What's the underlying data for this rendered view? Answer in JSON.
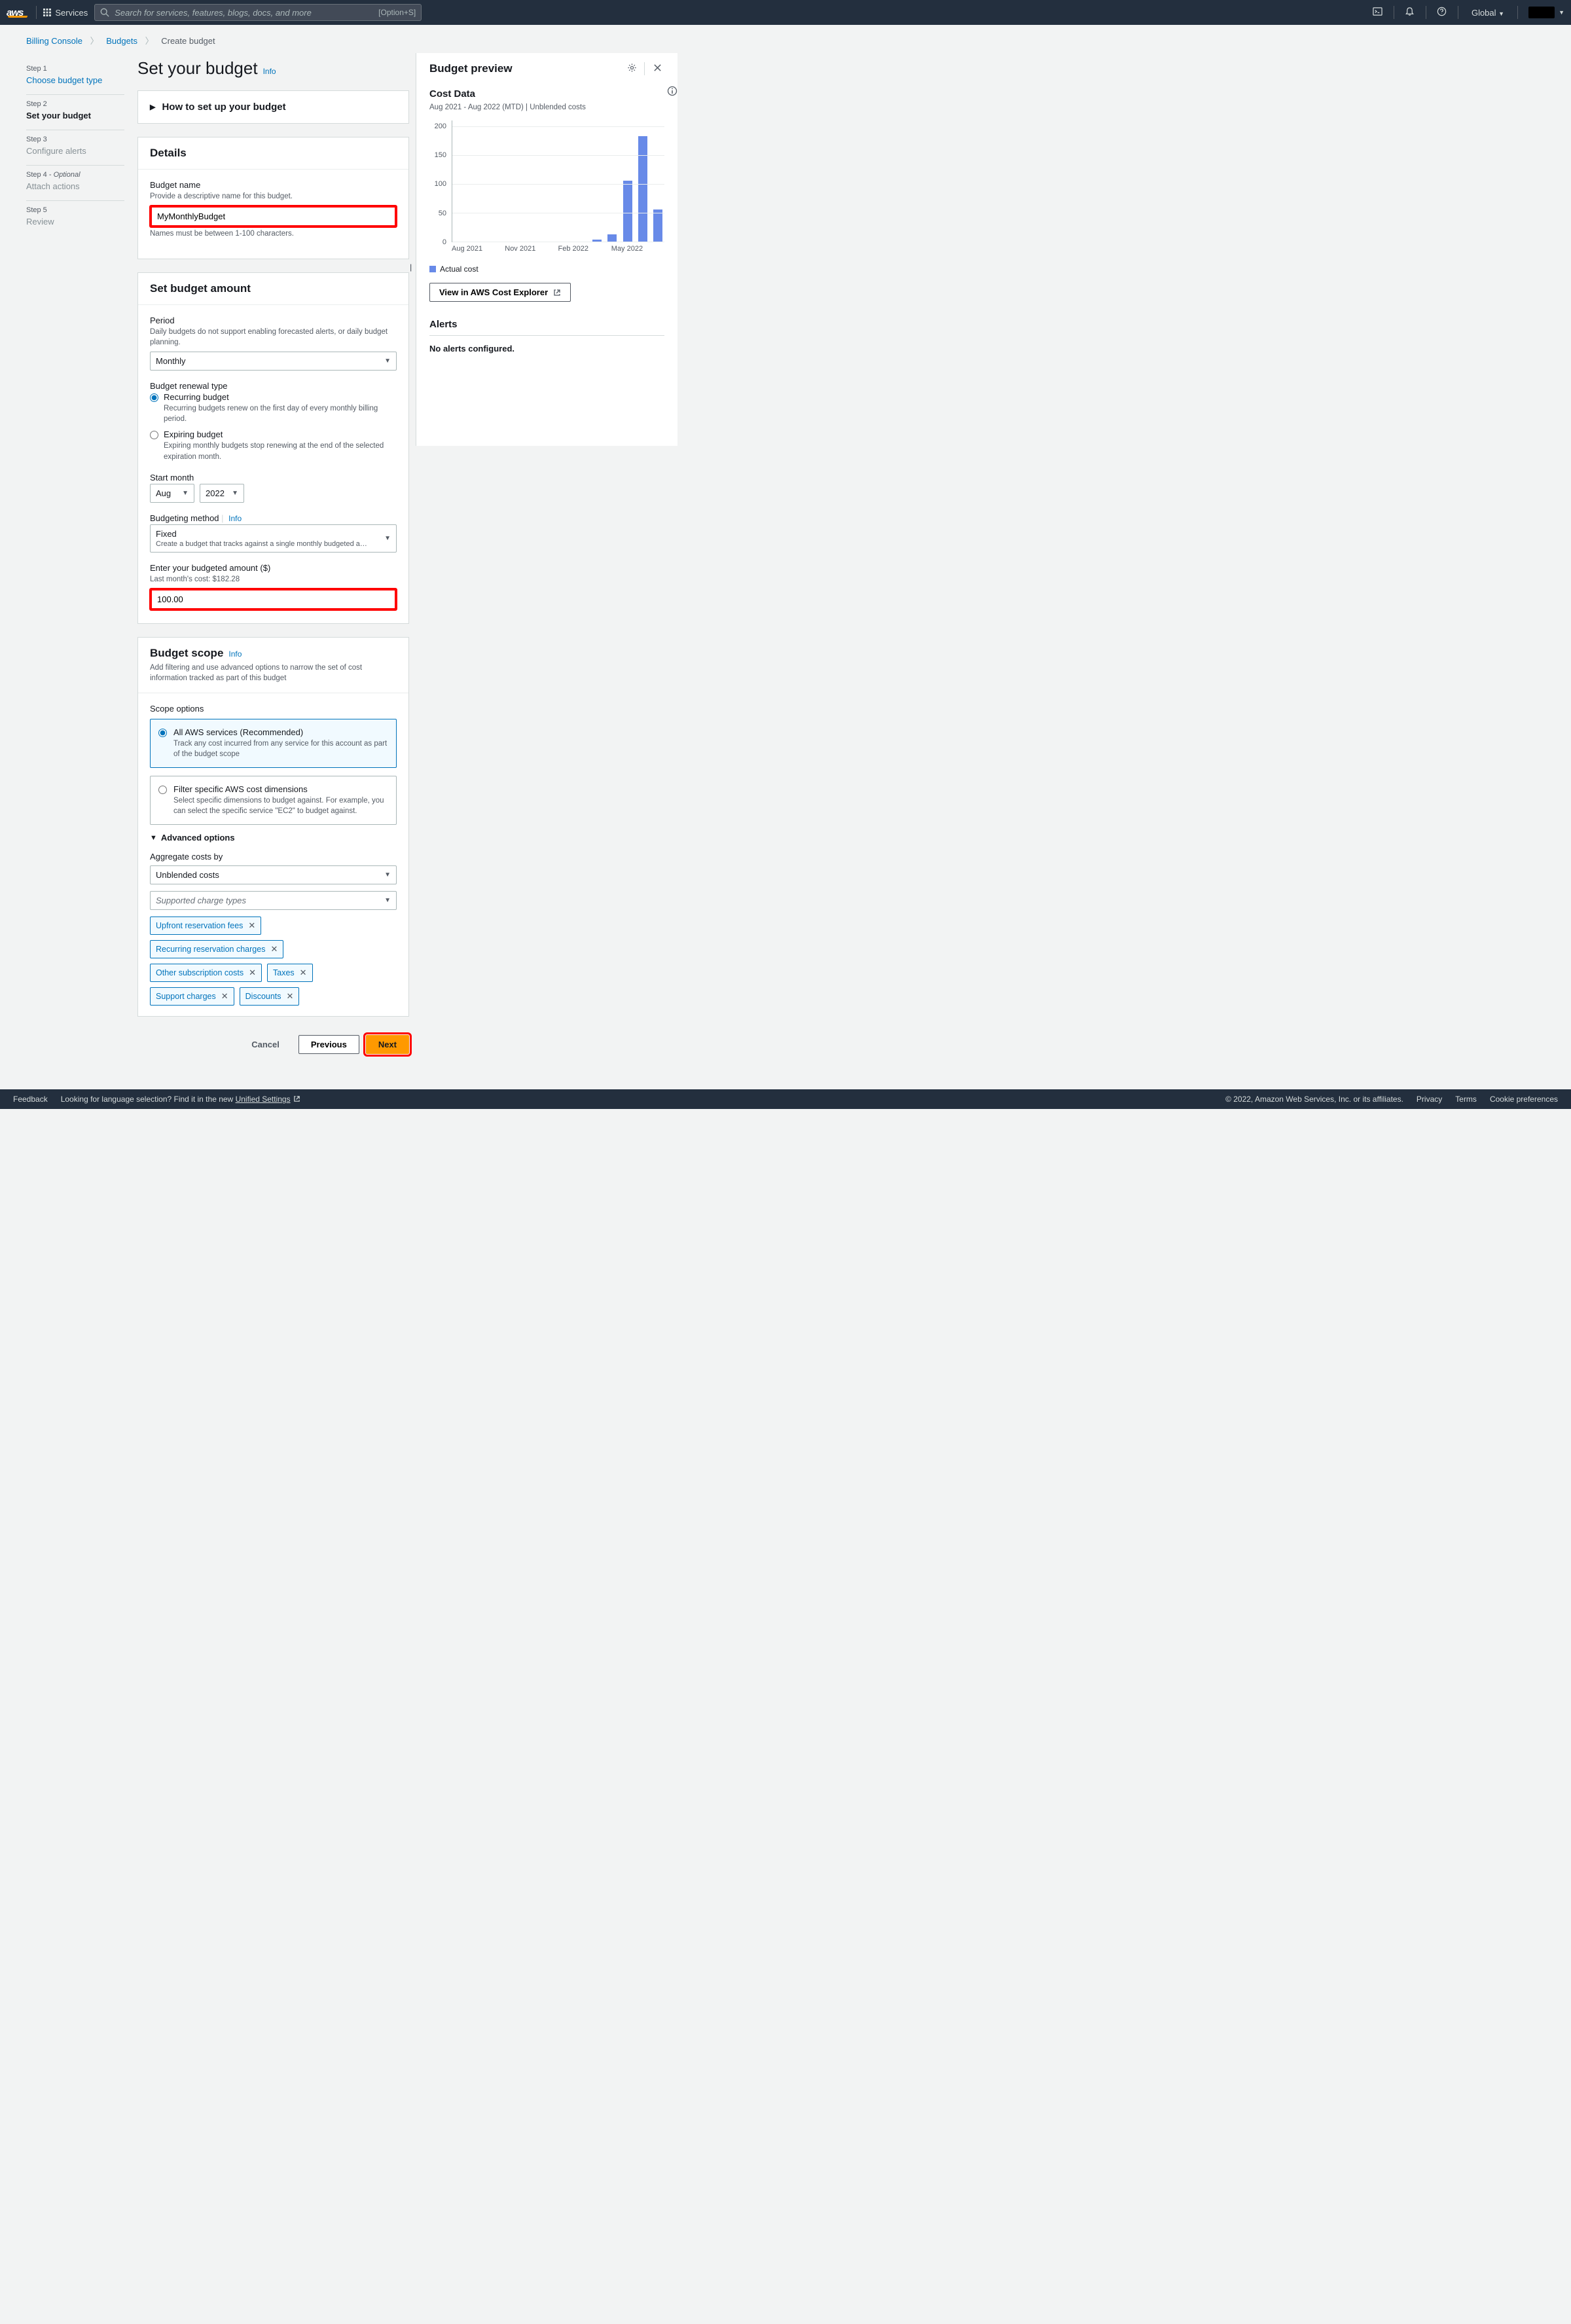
{
  "topnav": {
    "services": "Services",
    "search_placeholder": "Search for services, features, blogs, docs, and more",
    "search_hint": "[Option+S]",
    "region": "Global"
  },
  "breadcrumb": {
    "billing": "Billing Console",
    "budgets": "Budgets",
    "create": "Create budget"
  },
  "steps": {
    "s1_label": "Step 1",
    "s1_name": "Choose budget type",
    "s2_label": "Step 2",
    "s2_name": "Set your budget",
    "s3_label": "Step 3",
    "s3_name": "Configure alerts",
    "s4_label": "Step 4 - ",
    "s4_opt": "Optional",
    "s4_name": "Attach actions",
    "s5_label": "Step 5",
    "s5_name": "Review"
  },
  "page": {
    "title": "Set your budget",
    "info": "Info"
  },
  "howto": {
    "title": "How to set up your budget"
  },
  "details": {
    "heading": "Details",
    "name_label": "Budget name",
    "name_help": "Provide a descriptive name for this budget.",
    "name_value": "MyMonthlyBudget",
    "name_constraint": "Names must be between 1-100 characters."
  },
  "amount": {
    "heading": "Set budget amount",
    "period_label": "Period",
    "period_help": "Daily budgets do not support enabling forecasted alerts, or daily budget planning.",
    "period_value": "Monthly",
    "renewal_label": "Budget renewal type",
    "recurring_label": "Recurring budget",
    "recurring_help": "Recurring budgets renew on the first day of every monthly billing period.",
    "expiring_label": "Expiring budget",
    "expiring_help": "Expiring monthly budgets stop renewing at the end of the selected expiration month.",
    "start_label": "Start month",
    "start_month": "Aug",
    "start_year": "2022",
    "method_label": "Budgeting method",
    "method_info": "Info",
    "method_value": "Fixed",
    "method_help": "Create a budget that tracks against a single monthly budgeted a…",
    "enter_label": "Enter your budgeted amount ($)",
    "enter_help": "Last month's cost: $182.28",
    "enter_value": "100.00"
  },
  "scope": {
    "heading": "Budget scope",
    "info": "Info",
    "sub": "Add filtering and use advanced options to narrow the set of cost information tracked as part of this budget",
    "options_label": "Scope options",
    "all_label": "All AWS services (Recommended)",
    "all_help": "Track any cost incurred from any service for this account as part of the budget scope",
    "filter_label": "Filter specific AWS cost dimensions",
    "filter_help": "Select specific dimensions to budget against. For example, you can select the specific service \"EC2\" to budget against.",
    "adv_label": "Advanced options",
    "agg_label": "Aggregate costs by",
    "agg_value": "Unblended costs",
    "charge_placeholder": "Supported charge types",
    "tokens": [
      "Upfront reservation fees",
      "Recurring reservation charges",
      "Other subscription costs",
      "Taxes",
      "Support charges",
      "Discounts"
    ]
  },
  "buttons": {
    "cancel": "Cancel",
    "previous": "Previous",
    "next": "Next"
  },
  "preview": {
    "title": "Budget preview",
    "cost_title": "Cost Data",
    "cost_sub": "Aug 2021 - Aug 2022 (MTD) | Unblended costs",
    "legend": "Actual cost",
    "view_btn": "View in AWS Cost Explorer",
    "alerts_title": "Alerts",
    "alerts_empty": "No alerts configured."
  },
  "chart_data": {
    "type": "bar",
    "ylim": [
      0,
      210
    ],
    "y_ticks": [
      0,
      50,
      100,
      150,
      200
    ],
    "categories": [
      "Aug 2021",
      "Sep 2021",
      "Oct 2021",
      "Nov 2021",
      "Dec 2021",
      "Jan 2022",
      "Feb 2022",
      "Mar 2022",
      "Apr 2022",
      "May 2022",
      "Jun 2022",
      "Jul 2022",
      "Aug 2022"
    ],
    "x_tick_labels": [
      "Aug 2021",
      "Nov 2021",
      "Feb 2022",
      "May 2022"
    ],
    "values": [
      0,
      0,
      0,
      0,
      0,
      0,
      0,
      0,
      0,
      3,
      12,
      105,
      182,
      55
    ],
    "series_name": "Actual cost",
    "ylabel": "",
    "xlabel": ""
  },
  "footer": {
    "feedback": "Feedback",
    "lang_q": "Looking for language selection? Find it in the new",
    "unified": "Unified Settings",
    "copy": "© 2022, Amazon Web Services, Inc. or its affiliates.",
    "privacy": "Privacy",
    "terms": "Terms",
    "cookie": "Cookie preferences"
  }
}
